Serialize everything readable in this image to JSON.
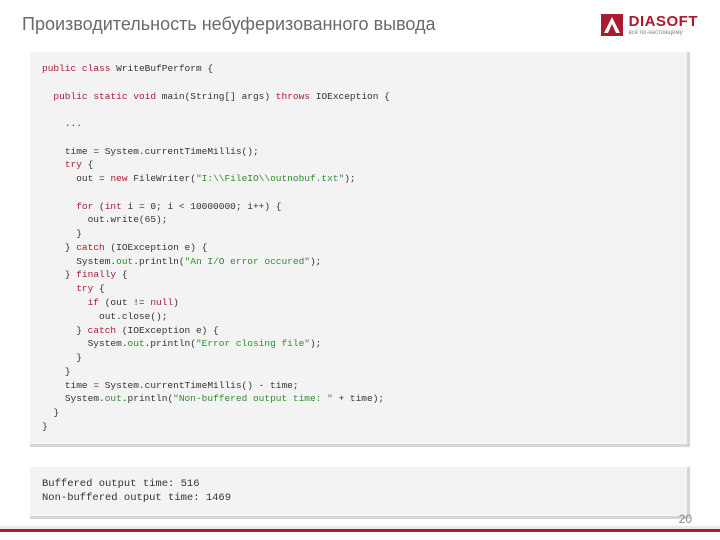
{
  "header": {
    "title": "Производительность небуферизованного вывода",
    "logo_name": "DIASOFT",
    "logo_tag": "всё по-настоящему"
  },
  "code": {
    "l1a": "public",
    "l1b": "class",
    "l1c": " WriteBufPerform {",
    "l2a": "public",
    "l2b": "static",
    "l2c": "void",
    "l2d": " main(String[] args) ",
    "l2e": "throws",
    "l2f": " IOException {",
    "l3": "...",
    "l4": "time = System.currentTimeMillis();",
    "l5a": "try",
    "l5b": " {",
    "l6a": "out = ",
    "l6b": "new",
    "l6c": " FileWriter(",
    "l6d": "\"I:\\\\FileIO\\\\outnobuf.txt\"",
    "l6e": ");",
    "l7a": "for",
    "l7b": " (",
    "l7c": "int",
    "l7d": " i = 0; i < 10000000; i++) {",
    "l8": "out.write(65);",
    "l9": "}",
    "l10a": "} ",
    "l10b": "catch",
    "l10c": " (IOException e) {",
    "l11a": "System.",
    "l11b": "out",
    "l11c": ".println(",
    "l11d": "\"An I/O error occured\"",
    "l11e": ");",
    "l12a": "} ",
    "l12b": "finally",
    "l12c": " {",
    "l13a": "try",
    "l13b": " {",
    "l14a": "if",
    "l14b": " (out != ",
    "l14c": "null",
    "l14d": ")",
    "l15": "out.close();",
    "l16a": "} ",
    "l16b": "catch",
    "l16c": " (IOException e) {",
    "l17a": "System.",
    "l17b": "out",
    "l17c": ".println(",
    "l17d": "\"Error closing file\"",
    "l17e": ");",
    "l18": "}",
    "l19": "}",
    "l20": "time = System.currentTimeMillis() - time;",
    "l21a": "System.",
    "l21b": "out",
    "l21c": ".println(",
    "l21d": "\"Non-buffered output time: \"",
    "l21e": " + time);",
    "l22": "}",
    "l23": "}"
  },
  "output": {
    "line1": "Buffered output time: 516",
    "line2": "Non-buffered output time: 1469"
  },
  "page_number": "20"
}
